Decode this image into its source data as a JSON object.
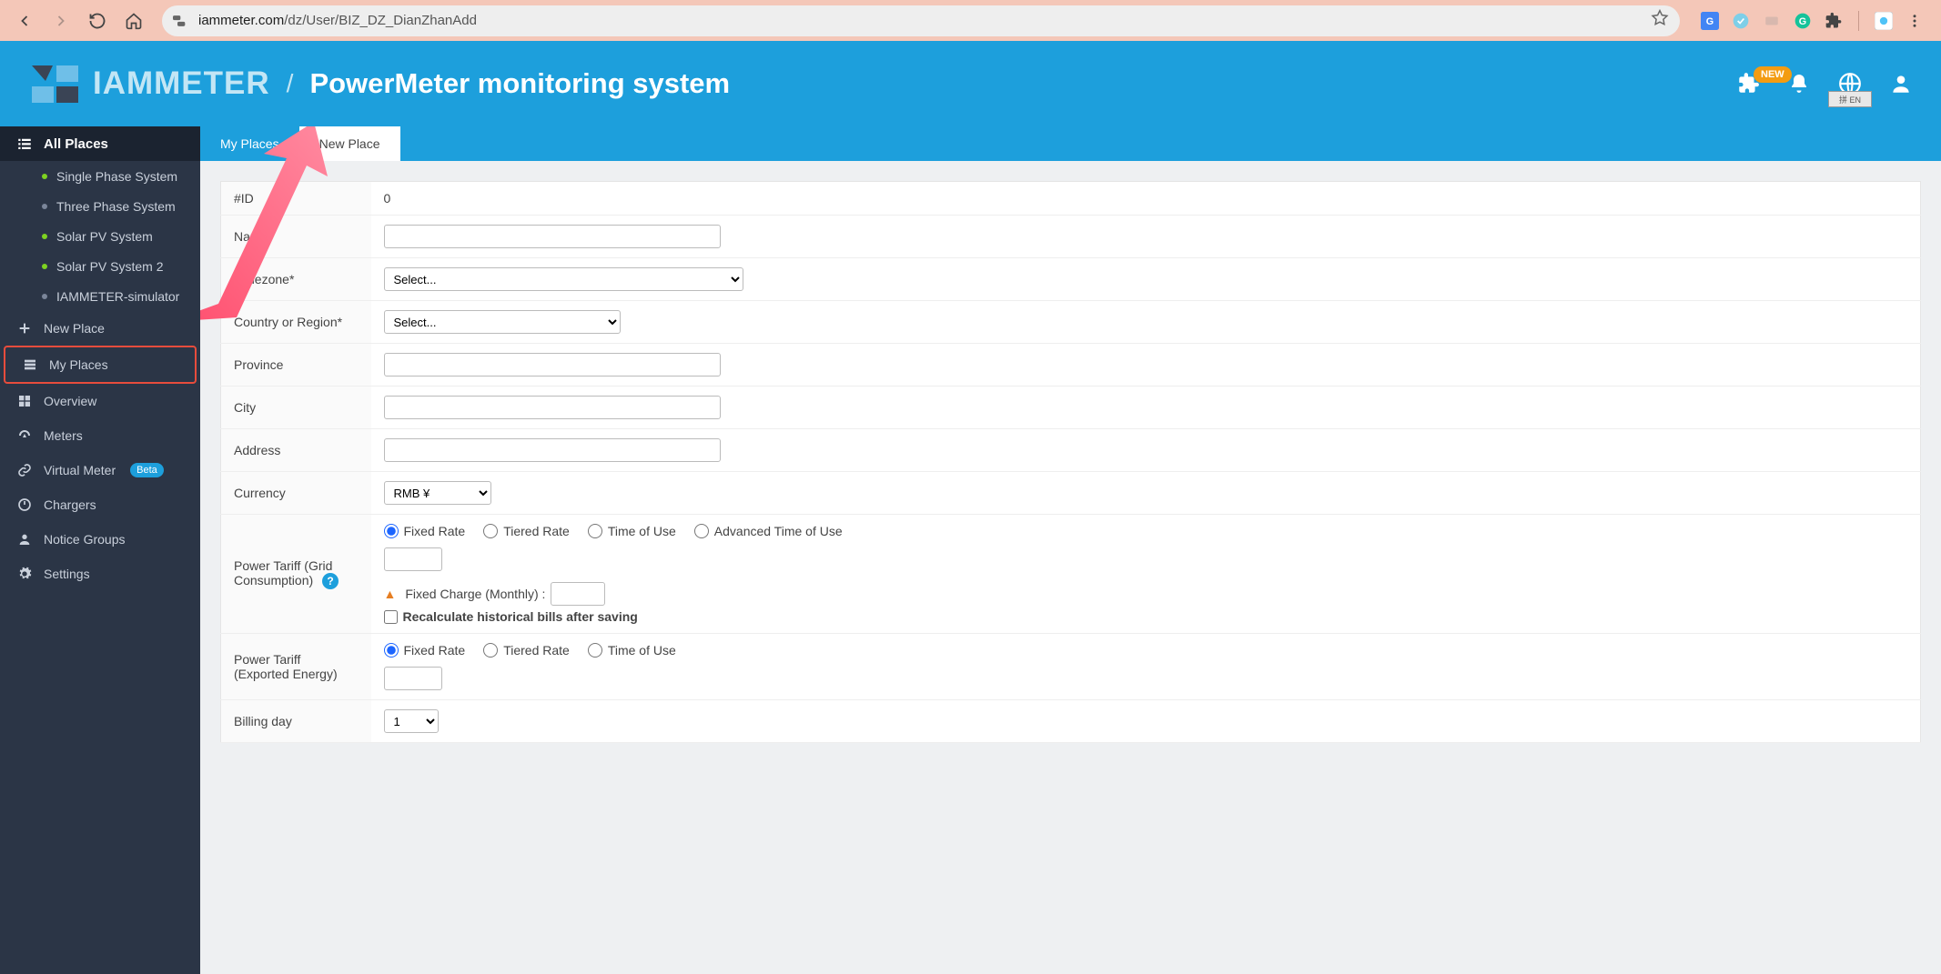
{
  "browser": {
    "url_domain": "iammeter.com",
    "url_path": "/dz/User/BIZ_DZ_DianZhanAdd"
  },
  "header": {
    "logo_text": "IAMMETER",
    "separator": "/",
    "title": "PowerMeter monitoring system",
    "new_badge": "NEW"
  },
  "sidebar": {
    "all_places": "All Places",
    "places": [
      {
        "label": "Single Phase System",
        "dot": "green"
      },
      {
        "label": "Three Phase System",
        "dot": "gray"
      },
      {
        "label": "Solar PV System",
        "dot": "green"
      },
      {
        "label": "Solar PV System 2",
        "dot": "green"
      },
      {
        "label": "IAMMETER-simulator",
        "dot": "gray"
      }
    ],
    "new_place": "New Place",
    "my_places": "My Places",
    "overview": "Overview",
    "meters": "Meters",
    "virtual_meter": "Virtual Meter",
    "beta": "Beta",
    "chargers": "Chargers",
    "notice_groups": "Notice Groups",
    "settings": "Settings"
  },
  "tabs": {
    "my_places": "My Places",
    "new_place": "New Place"
  },
  "form": {
    "id_label": "#ID",
    "id_value": "0",
    "name_label": "Name*",
    "timezone_label": "Timezone*",
    "timezone_value": "Select...",
    "country_label": "Country or Region*",
    "country_value": "Select...",
    "province_label": "Province",
    "city_label": "City",
    "address_label": "Address",
    "currency_label": "Currency",
    "currency_value": "RMB ¥",
    "tariff_grid_label": "Power Tariff (Grid Consumption)",
    "tariff_grid_help": "?",
    "rate_fixed": "Fixed Rate",
    "rate_tiered": "Tiered Rate",
    "rate_tou": "Time of Use",
    "rate_adv_tou": "Advanced Time of Use",
    "fixed_charge_label": "Fixed Charge (Monthly) :",
    "recalc_label": "Recalculate historical bills after saving",
    "tariff_export_label": "Power Tariff (Exported Energy)",
    "billing_day_label": "Billing day",
    "billing_day_value": "1"
  }
}
